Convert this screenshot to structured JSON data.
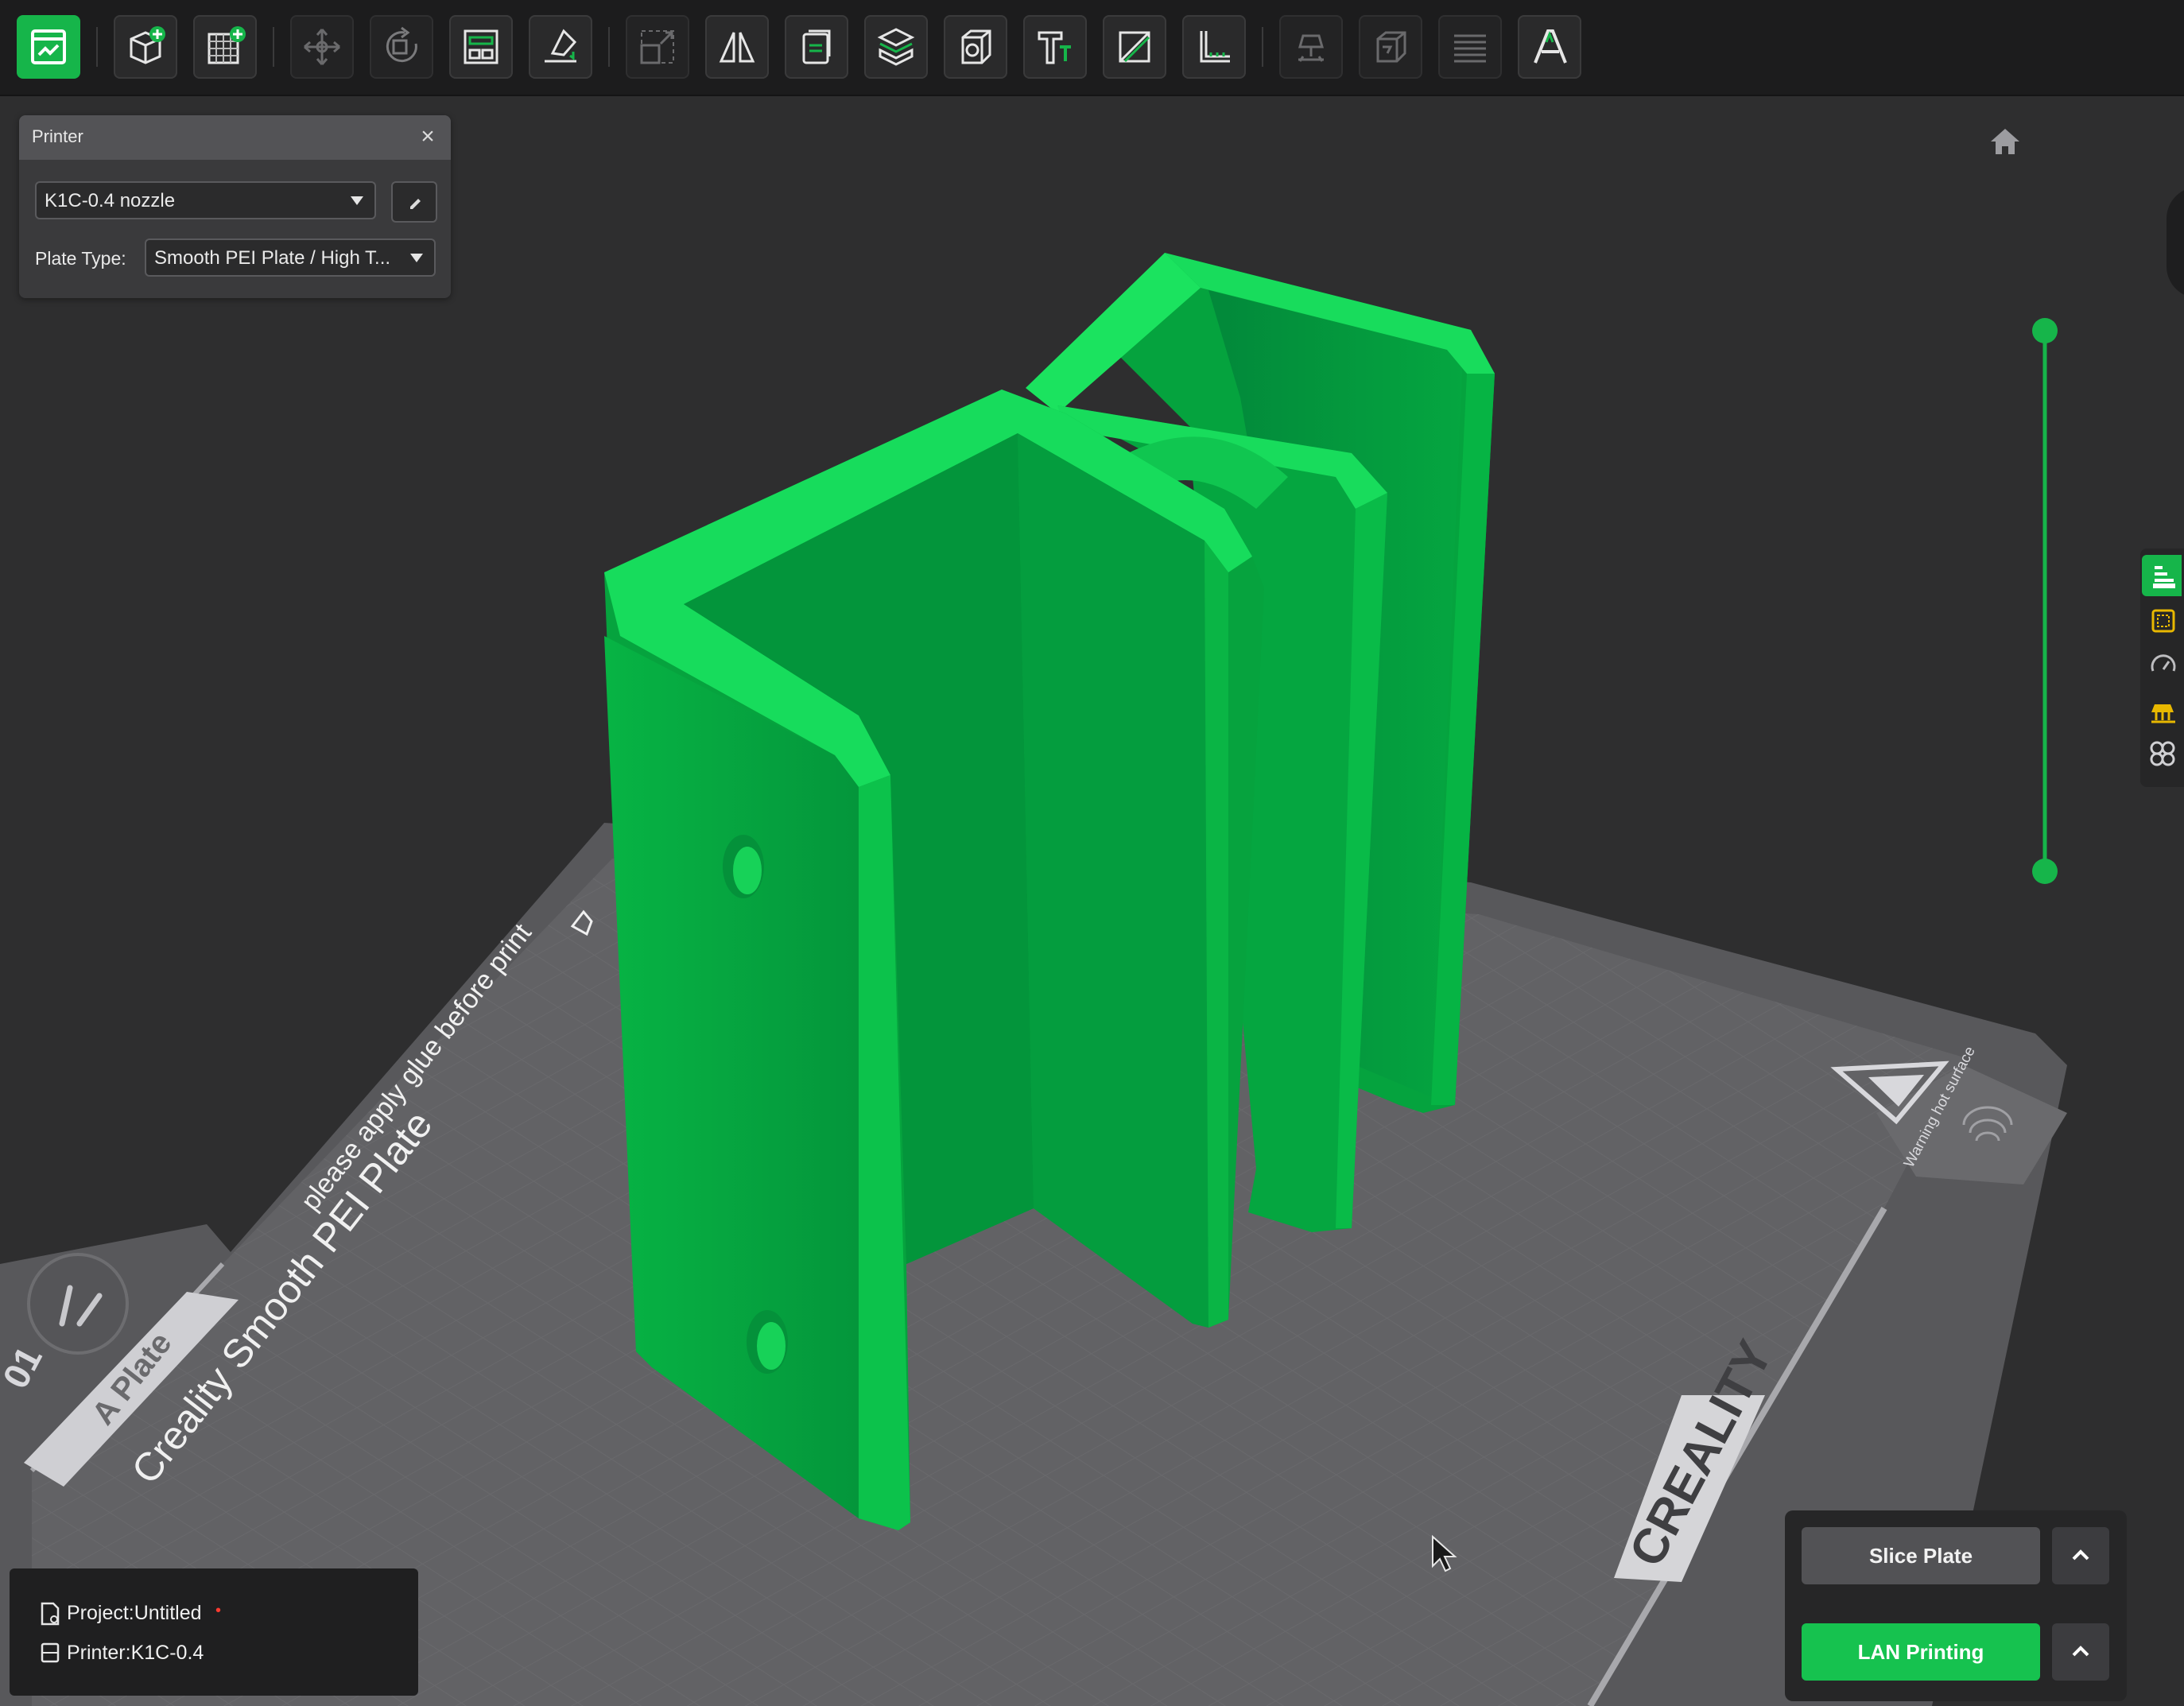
{
  "toolbar": {
    "items": [
      {
        "name": "prepare-view-icon",
        "active": true
      },
      {
        "name": "add-model-icon"
      },
      {
        "name": "add-plate-icon"
      },
      {
        "name": "move-icon",
        "dim": true
      },
      {
        "name": "rotate-icon",
        "dim": true
      },
      {
        "name": "arrange-icon"
      },
      {
        "name": "lay-flat-icon"
      },
      {
        "name": "scale-icon",
        "dim": true
      },
      {
        "name": "mirror-icon"
      },
      {
        "name": "copy-icon"
      },
      {
        "name": "cut-icon"
      },
      {
        "name": "hollow-icon"
      },
      {
        "name": "text-icon"
      },
      {
        "name": "split-icon"
      },
      {
        "name": "measure-icon"
      },
      {
        "name": "support-paint-icon",
        "dim": true
      },
      {
        "name": "seam-paint-icon",
        "dim": true
      },
      {
        "name": "layers-icon",
        "dim": true
      },
      {
        "name": "assembly-text-icon"
      }
    ]
  },
  "printer_panel": {
    "title": "Printer",
    "printer_value": "K1C-0.4 nozzle",
    "plate_type_label": "Plate Type:",
    "plate_type_value": "Smooth PEI Plate / High T..."
  },
  "bed": {
    "plate_name": "Creality Smooth PEI Plate",
    "glue_notice": "please apply glue before print",
    "plate_side": "A Plate",
    "brand": "CREALITY",
    "warning": "Warning hot surface",
    "corner_label": "01"
  },
  "project_info": {
    "project_label": "Project:Untitled",
    "printer_label": "Printer:K1C-0.4"
  },
  "actions": {
    "slice_label": "Slice Plate",
    "print_label": "LAN Printing"
  },
  "colors": {
    "accent": "#16b54a",
    "model_light": "#19d85a",
    "model_mid": "#06a63d",
    "model_dark": "#03863a",
    "bed": "#5d5d60"
  }
}
